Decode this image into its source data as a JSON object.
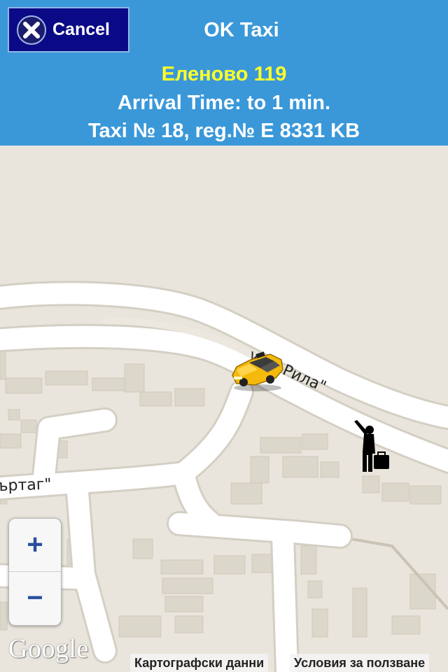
{
  "header": {
    "cancel_label": "Cancel",
    "title": "OK Taxi",
    "address": "Еленово 119",
    "arrival": "Arrival Time: to 1 min.",
    "taxi_info": "Taxi № 18, reg.№ E 8331 KB"
  },
  "map": {
    "street_labels": [
      "ул. „Рила\"",
      "ъртаг\""
    ],
    "zoom_in": "+",
    "zoom_out": "−",
    "logo": "Google",
    "map_data_label": "Картографски данни",
    "terms_label": "Условия за ползване"
  },
  "colors": {
    "header_bg": "#3a98d9",
    "cancel_bg": "#0a0a86",
    "address_text": "#ffff2a",
    "map_bg": "#e9e5dc",
    "road": "#ffffff",
    "building": "#dcd7cb"
  },
  "icons": [
    "close-icon",
    "taxi-car-icon",
    "passenger-icon"
  ]
}
